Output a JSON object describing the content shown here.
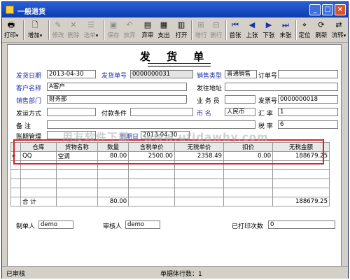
{
  "window": {
    "title": "一般退货"
  },
  "toolbar": [
    {
      "label": "打印",
      "icon": "printer-icon",
      "enabled": true
    },
    {
      "label": "增加",
      "icon": "add-icon",
      "enabled": true
    },
    {
      "label": "修改",
      "icon": "edit-icon",
      "enabled": false
    },
    {
      "label": "删除",
      "icon": "delete-icon",
      "enabled": false
    },
    {
      "label": "选单",
      "icon": "select-icon",
      "enabled": false
    },
    {
      "label": "保存",
      "icon": "save-icon",
      "enabled": false
    },
    {
      "label": "放弃",
      "icon": "discard-icon",
      "enabled": false
    },
    {
      "label": "弃审",
      "icon": "unapprove-icon",
      "enabled": true
    },
    {
      "label": "支出",
      "icon": "payout-icon",
      "enabled": true
    },
    {
      "label": "打开",
      "icon": "open-icon",
      "enabled": true
    },
    {
      "label": "增行",
      "icon": "add-row-icon",
      "enabled": false
    },
    {
      "label": "删行",
      "icon": "delete-row-icon",
      "enabled": false
    },
    {
      "label": "首张",
      "icon": "first-icon",
      "enabled": true
    },
    {
      "label": "上张",
      "icon": "prev-icon",
      "enabled": true
    },
    {
      "label": "下张",
      "icon": "next-icon",
      "enabled": true
    },
    {
      "label": "末张",
      "icon": "last-icon",
      "enabled": true
    },
    {
      "label": "定位",
      "icon": "locate-icon",
      "enabled": true
    },
    {
      "label": "刷新",
      "icon": "refresh-icon",
      "enabled": true
    },
    {
      "label": "流转",
      "icon": "flow-icon",
      "enabled": true
    }
  ],
  "form": {
    "title": "发  货  单",
    "ship_date_label": "发货日期",
    "ship_date": "2013-04-30",
    "ship_no_label": "发货单号",
    "ship_no": "0000000031",
    "sales_type_label": "销售类型",
    "sales_type": "普通销售",
    "order_no_label": "订单号",
    "order_no": "",
    "customer_label": "客户名称",
    "customer": "A客户",
    "ship_addr_label": "发往地址",
    "ship_addr": "",
    "dept_label": "销售部门",
    "dept": "财务部",
    "salesperson_label": "业 务 员",
    "salesperson": "",
    "invoice_no_label": "发票号",
    "invoice_no": "0000000018",
    "ship_method_label": "发运方式",
    "ship_method": "",
    "pay_terms_label": "付款条件",
    "pay_terms": "",
    "currency_label": "币    名",
    "currency": "人民币",
    "rate_label": "汇  率",
    "rate": "1",
    "remark_label": "备    注",
    "remark": "",
    "tax_label": "税  率",
    "tax": "6",
    "ageing_label": "账期管理",
    "due_date_label": "到期日",
    "due_date": "2013-04-30",
    "maker_label": "制单人",
    "maker": "demo",
    "auditor_label": "审核人",
    "auditor": "demo",
    "printed_label": "已打印次数",
    "printed": "0"
  },
  "watermark": "用友软件下载 - www.ufidawhy.com",
  "grid": {
    "headers": [
      "",
      "仓库",
      "货物名称",
      "数量",
      "含税单价",
      "无税单价",
      "扣价",
      "无税金额"
    ],
    "rows": [
      [
        "▸",
        "QQ",
        "空调",
        "80.00",
        "2500.00",
        "2358.49",
        "0.00",
        "188679.25"
      ]
    ],
    "total": [
      "合  计",
      "80.00",
      "188679.25"
    ]
  },
  "status": {
    "left": "已审核",
    "rows": "单据体行数：1"
  }
}
